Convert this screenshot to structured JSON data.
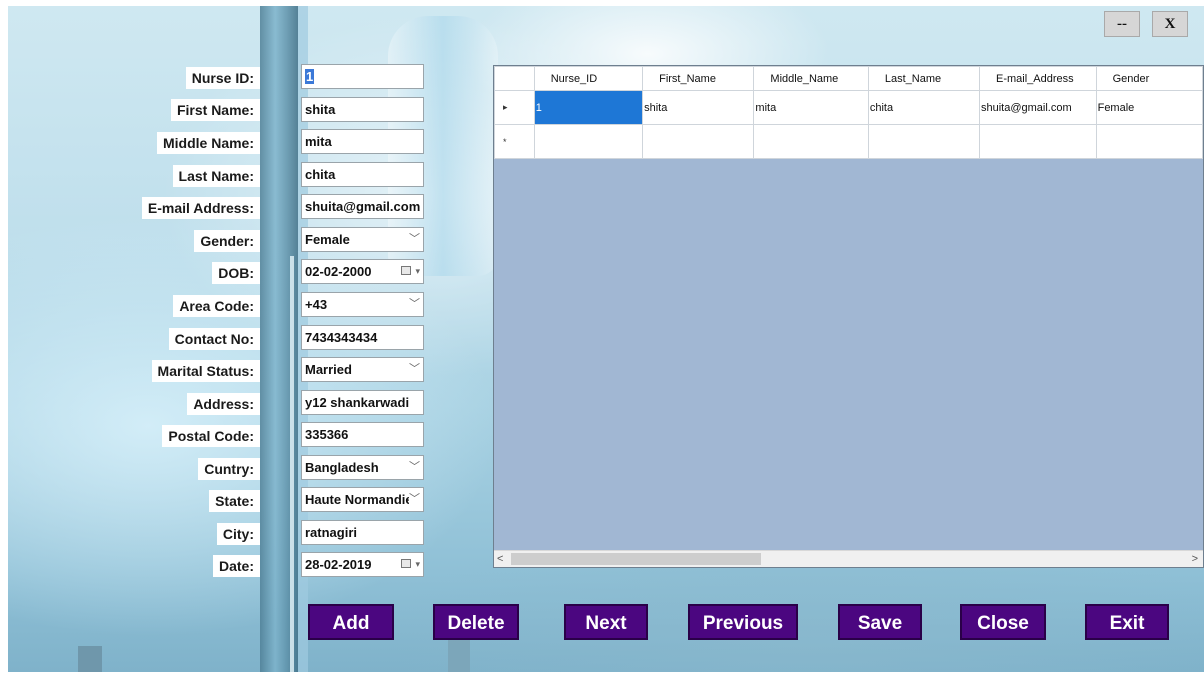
{
  "window": {
    "minimize_label": "--",
    "close_label": "X"
  },
  "form": {
    "fields": [
      {
        "label": "Nurse ID:",
        "value": "1"
      },
      {
        "label": "First Name:",
        "value": "shita"
      },
      {
        "label": "Middle Name:",
        "value": "mita"
      },
      {
        "label": "Last Name:",
        "value": "chita"
      },
      {
        "label": "E-mail Address:",
        "value": "shuita@gmail.com"
      },
      {
        "label": "Gender:",
        "value": "Female"
      },
      {
        "label": "DOB:",
        "value": "02-02-2000"
      },
      {
        "label": "Area Code:",
        "value": "+43"
      },
      {
        "label": "Contact No:",
        "value": "7434343434"
      },
      {
        "label": "Marital Status:",
        "value": "Married"
      },
      {
        "label": "Address:",
        "value": "y12 shankarwadi"
      },
      {
        "label": "Postal Code:",
        "value": "335366"
      },
      {
        "label": "Cuntry:",
        "value": "Bangladesh"
      },
      {
        "label": "State:",
        "value": "Haute Normandie"
      },
      {
        "label": "City:",
        "value": "ratnagiri"
      },
      {
        "label": "Date:",
        "value": "28-02-2019"
      }
    ]
  },
  "grid": {
    "columns": [
      "Nurse_ID",
      "First_Name",
      "Middle_Name",
      "Last_Name",
      "E-mail_Address",
      "Gender"
    ],
    "rows": [
      [
        "1",
        "shita",
        "mita",
        "chita",
        "shuita@gmail.com",
        "Female"
      ]
    ],
    "current_row_marker": "▸",
    "new_row_marker": "*",
    "scroll_left": "<",
    "scroll_right": ">"
  },
  "buttons": {
    "add": "Add",
    "delete": "Delete",
    "next": "Next",
    "previous": "Previous",
    "save": "Save",
    "close": "Close",
    "exit": "Exit"
  },
  "icons": {
    "dropdown": "chevron-down-icon",
    "calendar": "calendar-icon"
  },
  "colors": {
    "button_bg": "#4b0680",
    "grid_bg": "#a1b7d3",
    "selected_cell": "#1e77d6"
  }
}
